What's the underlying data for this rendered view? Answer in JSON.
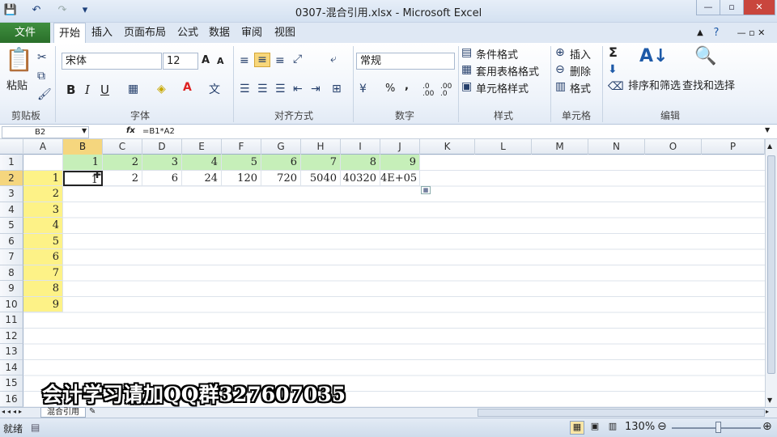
{
  "window": {
    "title": "0307-混合引用.xlsx - Microsoft Excel"
  },
  "tabs": [
    "文件",
    "开始",
    "插入",
    "页面布局",
    "公式",
    "数据",
    "审阅",
    "视图"
  ],
  "ribbon": {
    "clipboard": {
      "paste": "粘贴",
      "group": "剪贴板"
    },
    "font": {
      "name": "宋体",
      "size": "12",
      "group": "字体",
      "bold": "B",
      "italic": "I",
      "underline": "U",
      "grow": "A",
      "shrink": "A"
    },
    "align": {
      "group": "对齐方式"
    },
    "number": {
      "format": "常规",
      "group": "数字",
      "percent": "%",
      "comma": ",",
      "inc": ".0 .00",
      "dec": ".00 .0"
    },
    "styles": {
      "conditional": "条件格式",
      "table": "套用表格格式",
      "cell": "单元格样式",
      "group": "样式"
    },
    "cells": {
      "insert": "插入",
      "delete": "删除",
      "format": "格式",
      "group": "单元格"
    },
    "editing": {
      "sort": "排序和筛选",
      "find": "查找和选择",
      "group": "编辑",
      "sigma": "Σ"
    }
  },
  "formula_bar": {
    "name": "B2",
    "fx": "fx",
    "formula": "=B1*A2"
  },
  "columns": [
    "A",
    "B",
    "C",
    "D",
    "E",
    "F",
    "G",
    "H",
    "I",
    "J",
    "K",
    "L",
    "M",
    "N",
    "O",
    "P"
  ],
  "rows": [
    "1",
    "2",
    "3",
    "4",
    "5",
    "6",
    "7",
    "8",
    "9",
    "10",
    "11",
    "12",
    "13",
    "14",
    "15",
    "16"
  ],
  "row1": [
    "",
    "1",
    "2",
    "3",
    "4",
    "5",
    "6",
    "7",
    "8",
    "9"
  ],
  "row2": [
    "1",
    "1",
    "2",
    "6",
    "24",
    "120",
    "720",
    "5040",
    "40320",
    "4E+05"
  ],
  "colA": [
    "2",
    "3",
    "4",
    "5",
    "6",
    "7",
    "8",
    "9"
  ],
  "sheet_tab": "混合引用",
  "status": {
    "ready": "就绪",
    "zoom": "130%"
  },
  "overlay": "会计学习请加QQ群327607035"
}
